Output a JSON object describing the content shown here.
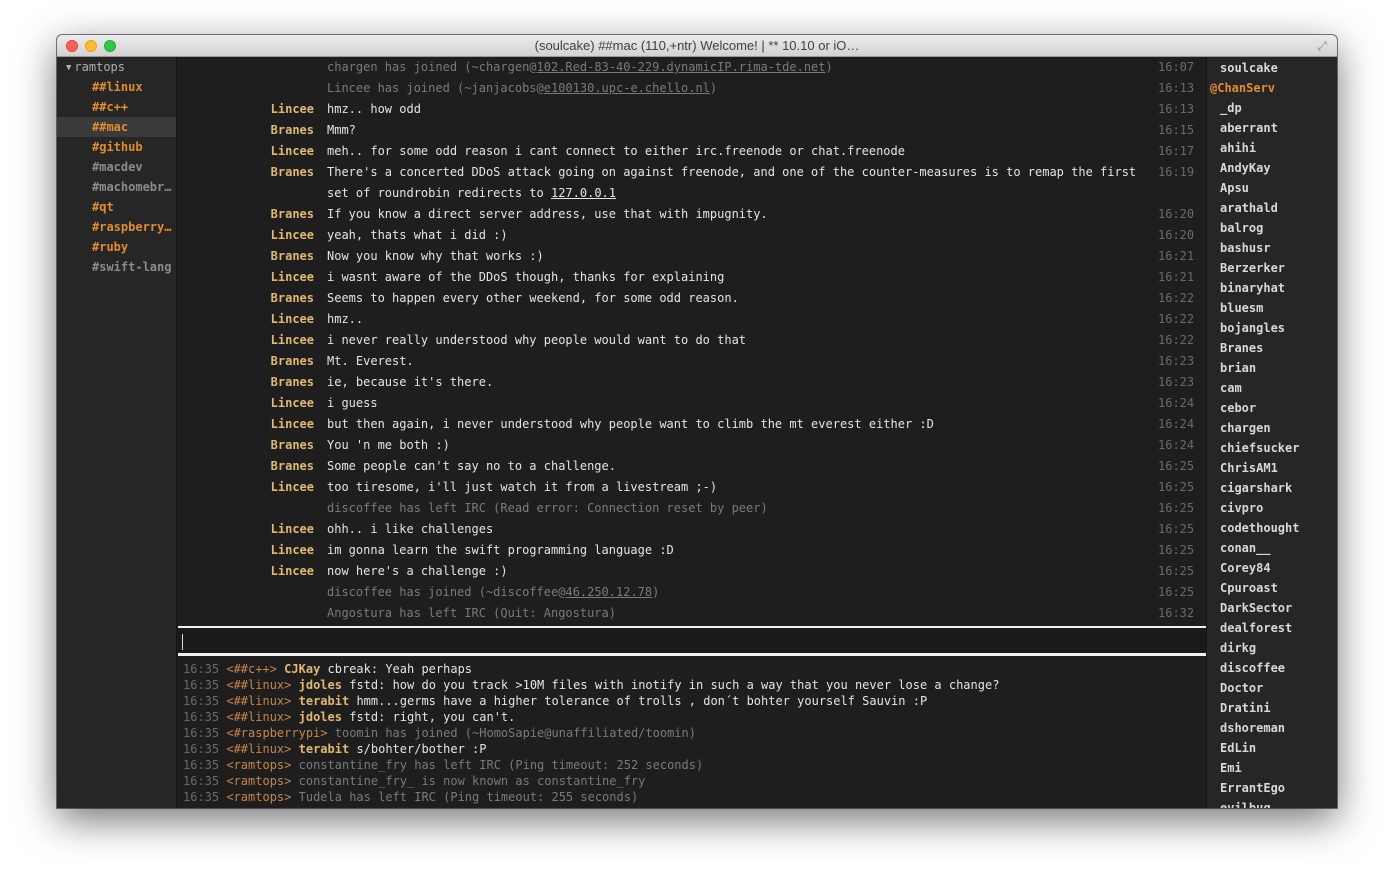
{
  "window": {
    "title": "(soulcake) ##mac (110,+ntr) Welcome! | ** 10.10 or iO…"
  },
  "sidebar": {
    "server": "ramtops",
    "channels": [
      {
        "name": "##linux",
        "state": "active"
      },
      {
        "name": "##c++",
        "state": "active"
      },
      {
        "name": "##mac",
        "state": "selected"
      },
      {
        "name": "#github",
        "state": "active"
      },
      {
        "name": "#macdev",
        "state": "dim"
      },
      {
        "name": "#machomebr…",
        "state": "dim"
      },
      {
        "name": "#qt",
        "state": "active"
      },
      {
        "name": "#raspberry…",
        "state": "active"
      },
      {
        "name": "#ruby",
        "state": "active"
      },
      {
        "name": "#swift-lang",
        "state": "dim"
      }
    ]
  },
  "chat": {
    "messages": [
      {
        "type": "status",
        "nick": "",
        "text": "chargen has joined (~chargen@",
        "link": "102.Red-83-40-229.dynamicIP.rima-tde.net",
        "after": ")",
        "time": "16:07"
      },
      {
        "type": "status",
        "nick": "",
        "text": "Lincee has joined (~janjacobs@",
        "link": "e100130.upc-e.chello.nl",
        "after": ")",
        "time": "16:13"
      },
      {
        "type": "msg",
        "nick": "Lincee",
        "text": "hmz.. how odd",
        "time": "16:13"
      },
      {
        "type": "msg",
        "nick": "Branes",
        "text": "Mmm?",
        "time": "16:15"
      },
      {
        "type": "msg",
        "nick": "Lincee",
        "text": "meh.. for some odd reason i cant connect to either irc.freenode or chat.freenode",
        "time": "16:17"
      },
      {
        "type": "msg",
        "nick": "Branes",
        "text": "There's a concerted DDoS attack going on against freenode, and one of the counter-measures is to remap the first set of roundrobin redirects to ",
        "link": "127.0.0.1",
        "after": "",
        "time": "16:19",
        "tall": true
      },
      {
        "type": "msg",
        "nick": "Branes",
        "text": "If you know a direct server address, use that with impugnity.",
        "time": "16:20"
      },
      {
        "type": "msg",
        "nick": "Lincee",
        "text": "yeah, thats what i did :)",
        "time": "16:20"
      },
      {
        "type": "msg",
        "nick": "Branes",
        "text": "Now you know why that works :)",
        "time": "16:21"
      },
      {
        "type": "msg",
        "nick": "Lincee",
        "text": "i wasnt aware of the DDoS though, thanks for explaining",
        "time": "16:21"
      },
      {
        "type": "msg",
        "nick": "Branes",
        "text": "Seems to happen every other weekend, for some odd reason.",
        "time": "16:22"
      },
      {
        "type": "msg",
        "nick": "Lincee",
        "text": "hmz..",
        "time": "16:22"
      },
      {
        "type": "msg",
        "nick": "Lincee",
        "text": "i never really understood why people would want to do that",
        "time": "16:22"
      },
      {
        "type": "msg",
        "nick": "Branes",
        "text": "Mt. Everest.",
        "time": "16:23"
      },
      {
        "type": "msg",
        "nick": "Branes",
        "text": "ie, because it's there.",
        "time": "16:23"
      },
      {
        "type": "msg",
        "nick": "Lincee",
        "text": "i guess",
        "time": "16:24"
      },
      {
        "type": "msg",
        "nick": "Lincee",
        "text": "but then again, i never understood why people want to climb the mt everest either :D",
        "time": "16:24"
      },
      {
        "type": "msg",
        "nick": "Branes",
        "text": "You 'n me both :)",
        "time": "16:24"
      },
      {
        "type": "msg",
        "nick": "Branes",
        "text": "Some people can't say no to a challenge.",
        "time": "16:25"
      },
      {
        "type": "msg",
        "nick": "Lincee",
        "text": "too tiresome, i'll just watch it from a livestream ;-)",
        "time": "16:25"
      },
      {
        "type": "status",
        "nick": "",
        "text": "discoffee has left IRC (Read error: Connection reset by peer)",
        "time": "16:25"
      },
      {
        "type": "msg",
        "nick": "Lincee",
        "text": "ohh.. i like challenges",
        "time": "16:25"
      },
      {
        "type": "msg",
        "nick": "Lincee",
        "text": "im gonna learn the swift programming language :D",
        "time": "16:25"
      },
      {
        "type": "msg",
        "nick": "Lincee",
        "text": "now here's a challenge :)",
        "time": "16:25"
      },
      {
        "type": "status",
        "nick": "",
        "text": "discoffee has joined (~discoffee@",
        "link": "46.250.12.78",
        "after": ")",
        "time": "16:25"
      },
      {
        "type": "status",
        "nick": "",
        "text": "Angostura has left IRC (Quit: Angostura)",
        "time": "16:32"
      }
    ]
  },
  "input": {
    "value": ""
  },
  "activity": [
    {
      "time": "16:35",
      "channel": "<##c++>",
      "nick": "CJKay",
      "text": "cbreak: Yeah perhaps",
      "status": false
    },
    {
      "time": "16:35",
      "channel": "<##linux>",
      "nick": "jdoles",
      "text": "fstd: how do you track >10M files with inotify in such a way that you never lose a change?",
      "status": false
    },
    {
      "time": "16:35",
      "channel": "<##linux>",
      "nick": "terabit",
      "text": "hmm...germs have a higher tolerance of trolls , don´t bohter yourself Sauvin :P",
      "status": false
    },
    {
      "time": "16:35",
      "channel": "<##linux>",
      "nick": "jdoles",
      "text": "fstd: right, you can't.",
      "status": false
    },
    {
      "time": "16:35",
      "channel": "<#raspberrypi>",
      "nick": "",
      "text": "toomin has joined (~HomoSapie@unaffiliated/toomin)",
      "status": true
    },
    {
      "time": "16:35",
      "channel": "<##linux>",
      "nick": "terabit",
      "text": "s/bohter/bother :P",
      "status": false
    },
    {
      "time": "16:35",
      "channel": "<ramtops>",
      "nick": "",
      "text": "constantine_fry has left IRC (Ping timeout: 252 seconds)",
      "status": true
    },
    {
      "time": "16:35",
      "channel": "<ramtops>",
      "nick": "",
      "text": "constantine_fry_ is now known as constantine_fry",
      "status": true
    },
    {
      "time": "16:35",
      "channel": "<ramtops>",
      "nick": "",
      "text": "Tudela has left IRC (Ping timeout: 255 seconds)",
      "status": true
    }
  ],
  "users": [
    {
      "name": "soulcake",
      "op": false
    },
    {
      "name": "@ChanServ",
      "op": true
    },
    {
      "name": "_dp",
      "op": false
    },
    {
      "name": "aberrant",
      "op": false
    },
    {
      "name": "ahihi",
      "op": false
    },
    {
      "name": "AndyKay",
      "op": false
    },
    {
      "name": "Apsu",
      "op": false
    },
    {
      "name": "arathald",
      "op": false
    },
    {
      "name": "balrog",
      "op": false
    },
    {
      "name": "bashusr",
      "op": false
    },
    {
      "name": "Berzerker",
      "op": false
    },
    {
      "name": "binaryhat",
      "op": false
    },
    {
      "name": "bluesm",
      "op": false
    },
    {
      "name": "bojangles",
      "op": false
    },
    {
      "name": "Branes",
      "op": false
    },
    {
      "name": "brian",
      "op": false
    },
    {
      "name": "cam",
      "op": false
    },
    {
      "name": "cebor",
      "op": false
    },
    {
      "name": "chargen",
      "op": false
    },
    {
      "name": "chiefsucker",
      "op": false
    },
    {
      "name": "ChrisAM1",
      "op": false
    },
    {
      "name": "cigarshark",
      "op": false
    },
    {
      "name": "civpro",
      "op": false
    },
    {
      "name": "codethought",
      "op": false
    },
    {
      "name": "conan__",
      "op": false
    },
    {
      "name": "Corey84",
      "op": false
    },
    {
      "name": "Cpuroast",
      "op": false
    },
    {
      "name": "DarkSector",
      "op": false
    },
    {
      "name": "dealforest",
      "op": false
    },
    {
      "name": "dirkg",
      "op": false
    },
    {
      "name": "discoffee",
      "op": false
    },
    {
      "name": "Doctor",
      "op": false
    },
    {
      "name": "Dratini",
      "op": false
    },
    {
      "name": "dshoreman",
      "op": false
    },
    {
      "name": "EdLin",
      "op": false
    },
    {
      "name": "Emi",
      "op": false
    },
    {
      "name": "ErrantEgo",
      "op": false
    },
    {
      "name": "evilbug",
      "op": false
    }
  ]
}
